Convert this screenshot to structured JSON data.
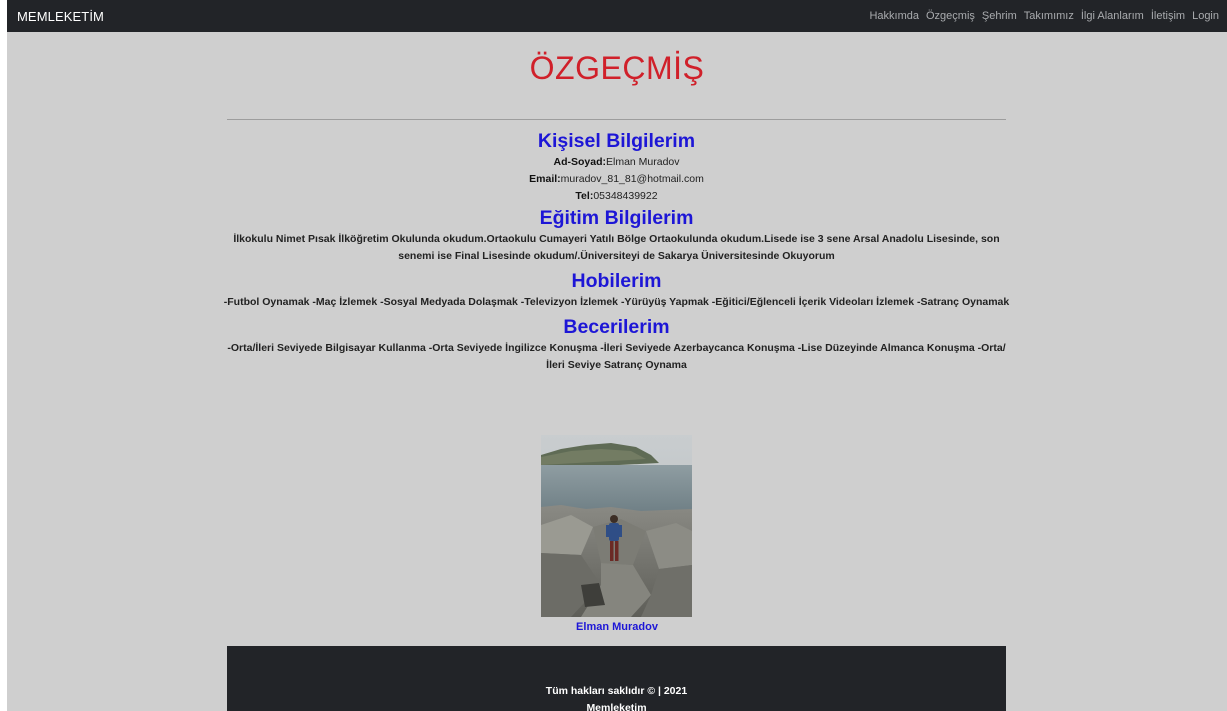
{
  "navbar": {
    "brand": "MEMLEKETİM",
    "links": [
      "Hakkımda",
      "Özgeçmiş",
      "Şehrim",
      "Takımımız",
      "İlgi Alanlarım",
      "İletişim",
      "Login"
    ]
  },
  "page": {
    "title": "ÖZGEÇMİŞ"
  },
  "personal": {
    "title": "Kişisel Bilgilerim",
    "name_label": "Ad-Soyad:",
    "name_value": "Elman Muradov",
    "email_label": "Email:",
    "email_value": "muradov_81_81@hotmail.com",
    "tel_label": "Tel:",
    "tel_value": "05348439922"
  },
  "education": {
    "title": "Eğitim Bilgilerim",
    "text": "İlkokulu Nimet Pısak İlköğretim Okulunda okudum.Ortaokulu Cumayeri Yatılı Bölge Ortaokulunda okudum.Lisede ise 3 sene Arsal Anadolu Lisesinde, son senemi ise Final Lisesinde okudum/.Üniversiteyi de Sakarya Üniversitesinde Okuyorum"
  },
  "hobbies": {
    "title": "Hobilerim",
    "text": "-Futbol Oynamak -Maç İzlemek -Sosyal Medyada Dolaşmak -Televizyon İzlemek -Yürüyüş Yapmak -Eğitici/Eğlenceli İçerik Videoları İzlemek -Satranç Oynamak"
  },
  "skills": {
    "title": "Becerilerim",
    "text": "-Orta/İleri Seviyede Bilgisayar Kullanma -Orta Seviyede İngilizce Konuşma -İleri Seviyede Azerbaycanca Konuşma -Lise Düzeyinde Almanca Konuşma -Orta/İleri Seviye Satranç Oynama"
  },
  "photo": {
    "caption": "Elman Muradov"
  },
  "footer": {
    "line1": "Tüm hakları saklıdır © | 2021",
    "line2": "Memleketim"
  },
  "colors": {
    "navbar_bg": "#222428",
    "page_bg": "#cfcfcf",
    "title_red": "#d0202a",
    "heading_blue": "#1d16d6"
  }
}
